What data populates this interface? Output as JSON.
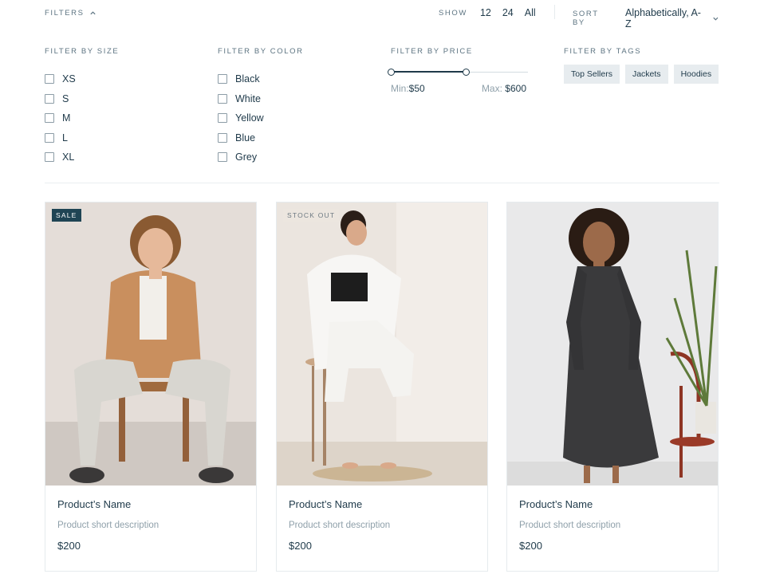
{
  "toolbar": {
    "filters_label": "FILTERS",
    "show_label": "SHOW",
    "show_options": [
      "12",
      "24",
      "All"
    ],
    "sort_label": "SORT BY",
    "sort_value": "Alphabetically, A-Z"
  },
  "filters": {
    "size": {
      "title": "FILTER BY SIZE",
      "options": [
        "XS",
        "S",
        "M",
        "L",
        "XL"
      ]
    },
    "color": {
      "title": "FILTER BY COLOR",
      "options": [
        "Black",
        "White",
        "Yellow",
        "Blue",
        "Grey"
      ]
    },
    "price": {
      "title": "FILTER BY PRICE",
      "min_label": "Min:",
      "min_value": "$50",
      "max_label": "Max:",
      "max_value": "$600",
      "selected_range_fraction": [
        0.0,
        0.55
      ]
    },
    "tags": {
      "title": "FILTER BY TAGS",
      "options": [
        "Top Sellers",
        "Jackets",
        "Hoodies"
      ]
    }
  },
  "products": [
    {
      "badge": "SALE",
      "name": "Product’s Name",
      "description": "Product short description",
      "price": "$200"
    },
    {
      "badge": "STOCK OUT",
      "name": "Product’s Name",
      "description": "Product short description",
      "price": "$200"
    },
    {
      "badge": "",
      "name": "Product’s Name",
      "description": "Product short description",
      "price": "$200"
    }
  ],
  "icons": {
    "filters_toggle": "chevron-up-icon",
    "sort_dropdown": "chevron-down-icon"
  },
  "colors": {
    "text": "#1f3a4a",
    "muted": "#8fa0aa",
    "sale_badge": "#1f4454",
    "tag_bg": "#e7ecef"
  }
}
